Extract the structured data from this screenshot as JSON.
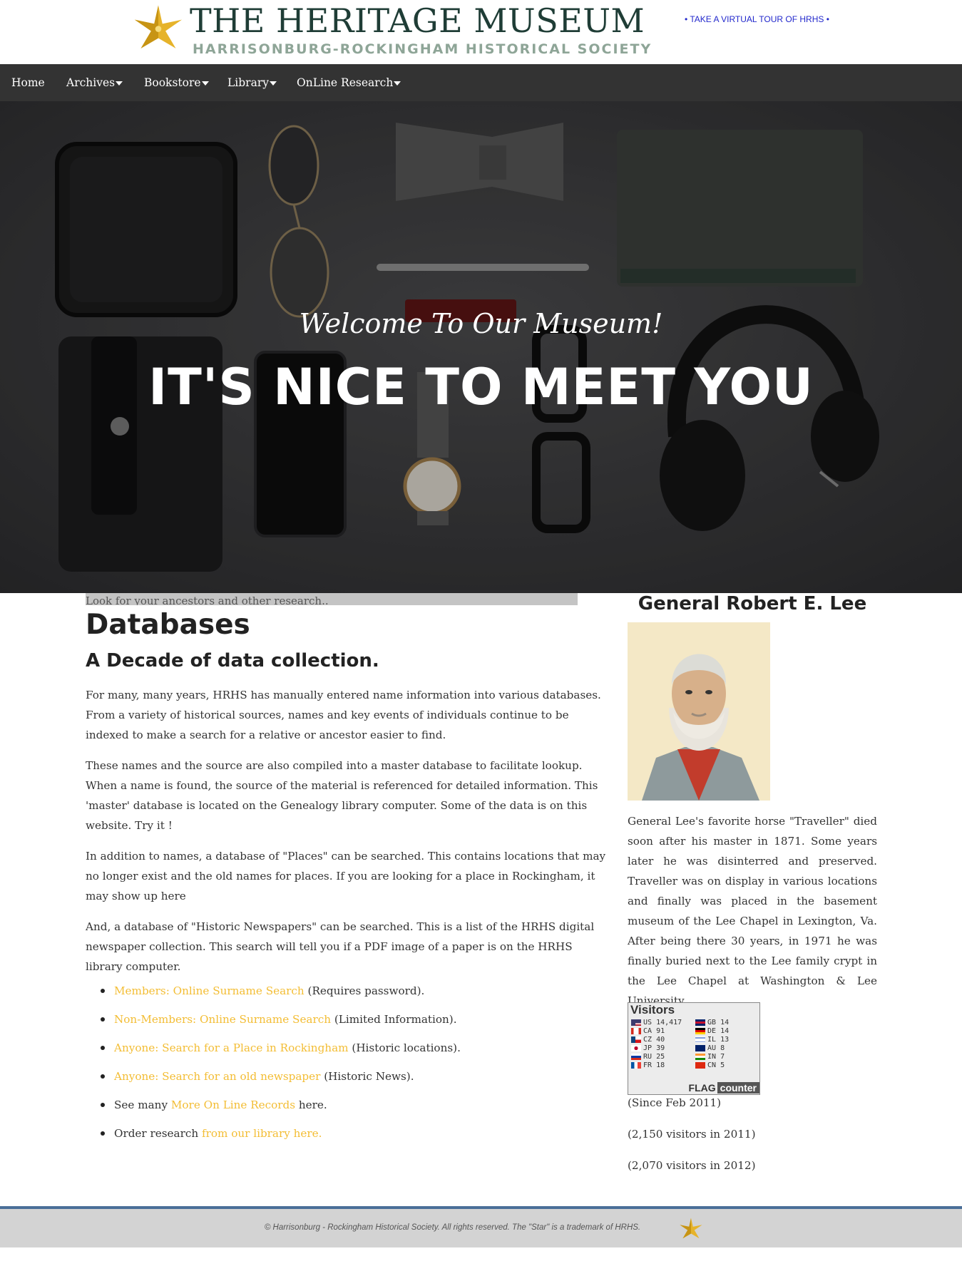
{
  "header": {
    "title": "THE HERITAGE MUSEUM",
    "subtitle": "HARRISONBURG-ROCKINGHAM HISTORICAL SOCIETY",
    "virtual_tour": "• TAKE A VIRTUAL TOUR OF HRHS •"
  },
  "nav": {
    "items": [
      {
        "label": "Home",
        "dropdown": false
      },
      {
        "label": "Archives",
        "dropdown": true
      },
      {
        "label": "Bookstore",
        "dropdown": true
      },
      {
        "label": "Library",
        "dropdown": true
      },
      {
        "label": "OnLine Research",
        "dropdown": true
      }
    ]
  },
  "hero": {
    "subheading": "Welcome To Our Museum!",
    "heading": "IT'S NICE TO MEET YOU"
  },
  "main": {
    "search_placeholder": "Look for your ancestors and other research..",
    "title": "Databases",
    "subtitle": "A Decade of data collection.",
    "paragraphs": [
      "For many, many years, HRHS has manually entered name information into various databases. From a variety of historical sources, names and key events of individuals continue to be indexed to make a search for a relative or ancestor easier to find.",
      "These names and the source are also compiled into a master database to facilitate lookup. When a name is found, the source of the material is referenced for detailed information. This 'master' database is located on the Genealogy library computer. Some of the data is on this website. Try it !",
      "In addition to names, a database of \"Places\" can be searched. This contains locations that may no longer exist and the old names for places. If you are looking for a place in Rockingham, it may show up here",
      "And, a database of \"Historic Newspapers\" can be searched. This is a list of the HRHS digital newspaper collection. This search will tell you if a PDF image of a paper is on the HRHS library computer."
    ],
    "links": [
      {
        "before": "",
        "link": "Members: Online Surname Search",
        "after": " (Requires password)."
      },
      {
        "before": "",
        "link": "Non-Members: Online Surname Search",
        "after": " (Limited Information)."
      },
      {
        "before": "",
        "link": "Anyone: Search for a Place in Rockingham",
        "after": " (Historic locations)."
      },
      {
        "before": "",
        "link": "Anyone: Search for an old newspaper",
        "after": " (Historic News)."
      },
      {
        "before": "See many ",
        "link": "More On Line Records",
        "after": " here."
      },
      {
        "before": "Order research ",
        "link": "from our library here.",
        "after": ""
      }
    ]
  },
  "sidebar": {
    "title": "General Robert E. Lee",
    "text": "General Lee's favorite horse \"Traveller\" died soon after his master in 1871. Some years later he was disinterred and preserved. Traveller was on display in various locations and finally was placed in the basement museum of the Lee Chapel in Lexington, Va. After being there 30 years, in 1971 he was finally buried next to the Lee family crypt in the Lee Chapel at Washington & Lee University.",
    "flag_counter": {
      "title": "Visitors",
      "brand_flag": "FLAG",
      "brand_counter": "counter",
      "rows": [
        {
          "code": "US",
          "count": "14,417"
        },
        {
          "code": "CA",
          "count": "91"
        },
        {
          "code": "CZ",
          "count": "40"
        },
        {
          "code": "JP",
          "count": "39"
        },
        {
          "code": "RU",
          "count": "25"
        },
        {
          "code": "FR",
          "count": "18"
        },
        {
          "code": "GB",
          "count": "14"
        },
        {
          "code": "DE",
          "count": "14"
        },
        {
          "code": "IL",
          "count": "13"
        },
        {
          "code": "AU",
          "count": "8"
        },
        {
          "code": "IN",
          "count": "7"
        },
        {
          "code": "CN",
          "count": "5"
        }
      ]
    },
    "notes": [
      "(Since Feb 2011)",
      "(2,150 visitors in 2011)",
      "(2,070 visitors in 2012)"
    ]
  },
  "footer": {
    "text": "© Harrisonburg - Rockingham Historical Society. All rights reserved. The \"Star\" is a trademark of HRHS."
  },
  "colors": {
    "nav_bg": "#333333",
    "link": "#f3bd34",
    "footer_border": "#4a6f98",
    "title_green": "#1f3d36",
    "virtual_tour_link": "#2228cc"
  }
}
